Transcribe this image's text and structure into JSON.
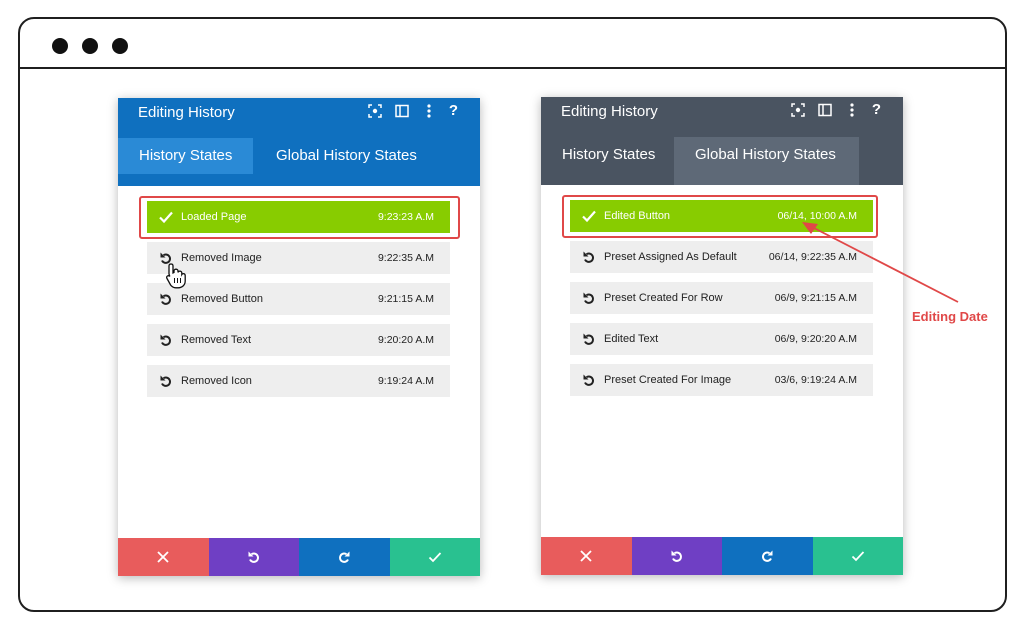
{
  "left_panel": {
    "title": "Editing History",
    "header_color": "#0f70bf",
    "tabs": [
      {
        "label": "History States",
        "active": true
      },
      {
        "label": "Global History States",
        "active": false
      }
    ],
    "rows": [
      {
        "label": "Loaded Page",
        "time": "9:23:23 A.M",
        "active": true
      },
      {
        "label": "Removed Image",
        "time": "9:22:35 A.M",
        "active": false
      },
      {
        "label": "Removed Button",
        "time": "9:21:15 A.M",
        "active": false
      },
      {
        "label": "Removed Text",
        "time": "9:20:20 A.M",
        "active": false
      },
      {
        "label": "Removed Icon",
        "time": "9:19:24 A.M",
        "active": false
      }
    ]
  },
  "right_panel": {
    "title": "Editing History",
    "header_color": "#4a5461",
    "tabs": [
      {
        "label": "History States",
        "active": false
      },
      {
        "label": "Global History States",
        "active": true
      }
    ],
    "rows": [
      {
        "label": "Edited Button",
        "time": "06/14, 10:00 A.M",
        "active": true
      },
      {
        "label": "Preset Assigned As Default",
        "time": "06/14, 9:22:35 A.M",
        "active": false
      },
      {
        "label": "Preset Created For Row",
        "time": "06/9, 9:21:15 A.M",
        "active": false
      },
      {
        "label": "Edited Text",
        "time": "06/9, 9:20:20 A.M",
        "active": false
      },
      {
        "label": "Preset Created For Image",
        "time": "03/6, 9:19:24 A.M",
        "active": false
      }
    ]
  },
  "header_icons": [
    "screenshot-icon",
    "sidebar-icon",
    "more-vertical-icon",
    "help-icon"
  ],
  "footer_buttons": [
    {
      "name": "close",
      "icon": "close-icon",
      "color": "#e85c5c"
    },
    {
      "name": "undo",
      "icon": "undo-icon",
      "color": "#6f3fc4"
    },
    {
      "name": "redo",
      "icon": "redo-icon",
      "color": "#0f70bf"
    },
    {
      "name": "save",
      "icon": "check-icon",
      "color": "#29c190"
    }
  ],
  "help_symbol": "?",
  "annotation": {
    "label": "Editing Date",
    "color": "#e04848"
  },
  "colors": {
    "active_row": "#88cc00",
    "row": "#eeeeee",
    "highlight": "#e04848"
  }
}
